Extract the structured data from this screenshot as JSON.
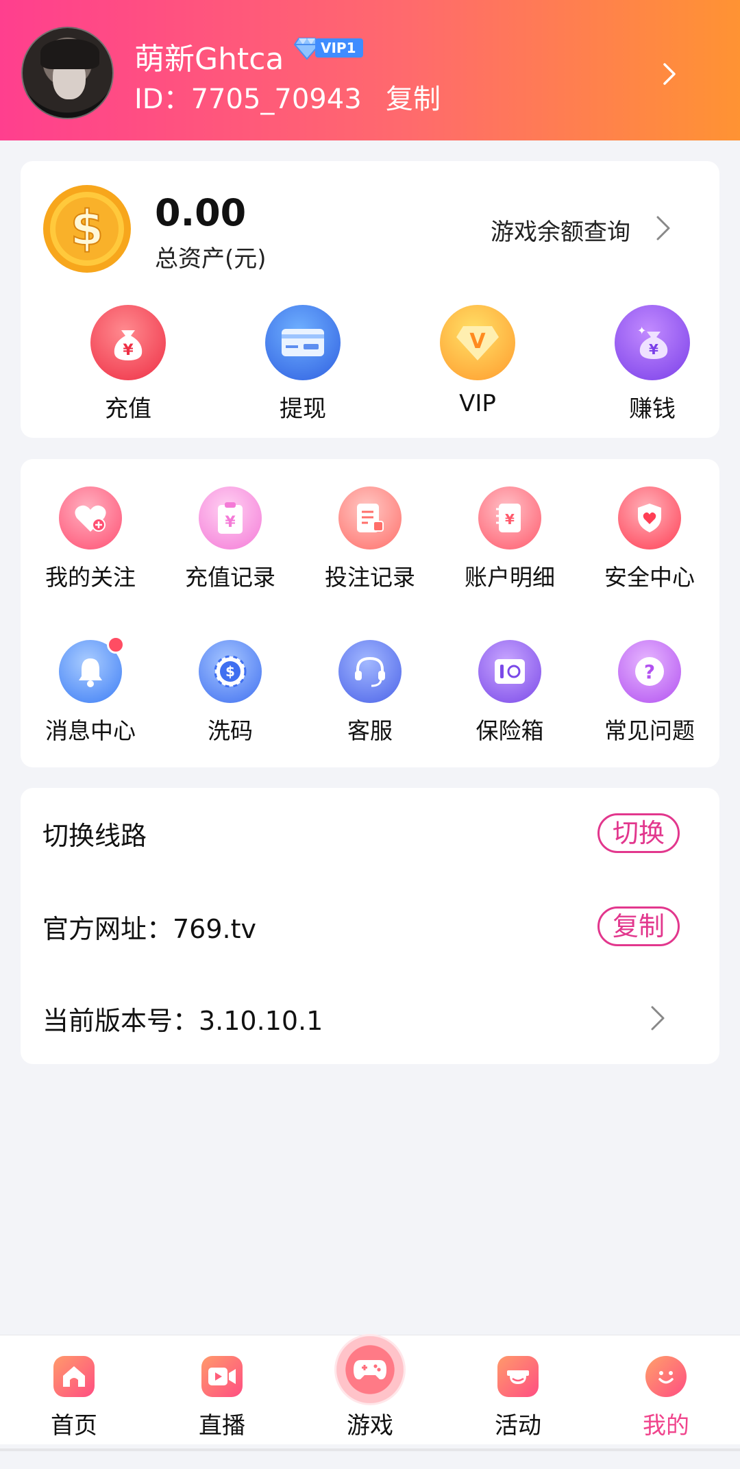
{
  "profile": {
    "username": "萌新Ghtca",
    "vip_level": "VIP1",
    "id_text": "ID：7705_70943",
    "copy_label": "复制"
  },
  "wallet": {
    "balance": "0.00",
    "balance_label": "总资产(元)",
    "query_label": "游戏余额查询"
  },
  "quick_actions": [
    {
      "label": "充值",
      "icon": "money-bag-icon"
    },
    {
      "label": "提现",
      "icon": "card-icon"
    },
    {
      "label": "VIP",
      "icon": "vip-diamond-icon"
    },
    {
      "label": "赚钱",
      "icon": "earn-bag-icon"
    }
  ],
  "menu_grid": [
    {
      "label": "我的关注",
      "icon": "heart-plus-icon"
    },
    {
      "label": "充值记录",
      "icon": "clipboard-yen-icon"
    },
    {
      "label": "投注记录",
      "icon": "bet-record-icon"
    },
    {
      "label": "账户明细",
      "icon": "ledger-icon"
    },
    {
      "label": "安全中心",
      "icon": "shield-heart-icon"
    },
    {
      "label": "消息中心",
      "icon": "bell-icon",
      "has_badge": true
    },
    {
      "label": "洗码",
      "icon": "chip-icon"
    },
    {
      "label": "客服",
      "icon": "headset-icon"
    },
    {
      "label": "保险箱",
      "icon": "safe-icon"
    },
    {
      "label": "常见问题",
      "icon": "question-icon"
    }
  ],
  "settings": {
    "switch_route_label": "切换线路",
    "switch_button": "切换",
    "website_label": "官方网址：769.tv",
    "copy_button": "复制",
    "version_label": "当前版本号：3.10.10.1"
  },
  "bottom_nav": [
    {
      "label": "首页",
      "icon": "home-icon"
    },
    {
      "label": "直播",
      "icon": "live-video-icon"
    },
    {
      "label": "游戏",
      "icon": "gamepad-icon"
    },
    {
      "label": "活动",
      "icon": "gift-icon"
    },
    {
      "label": "我的",
      "icon": "smiley-icon",
      "active": true
    }
  ],
  "colors": {
    "header_start": "#ff3f8e",
    "header_end": "#ff9333",
    "accent": "#e2378d",
    "active_nav": "#f0448c",
    "badge": "#ff4d63"
  }
}
